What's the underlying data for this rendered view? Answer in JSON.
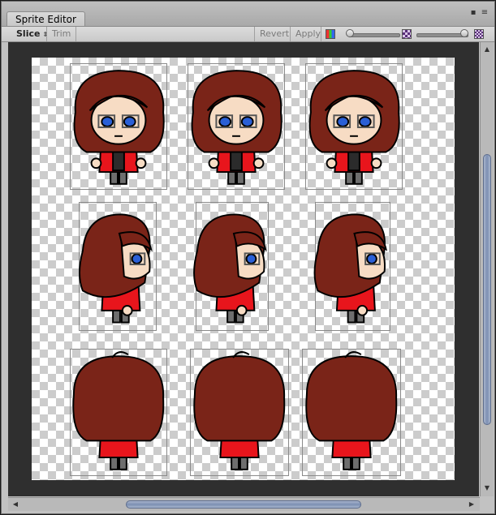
{
  "window": {
    "title": "Sprite Editor",
    "menu_icon": "window-menu-icon",
    "close_icon": "maximize-icon"
  },
  "toolbar": {
    "slice_label": "Slice",
    "slice_arrow": "⇕",
    "trim_label": "Trim",
    "revert_label": "Revert",
    "apply_label": "Apply",
    "rgb_icon": "color-channel-icon",
    "zoom_icon": "zoom-checker-icon",
    "mip_icon": "mipmap-checker-icon",
    "zoom_level": 0.0,
    "mip_level": 1.0
  },
  "scroll": {
    "vertical_position": 0.35,
    "horizontal_position": 0.5
  },
  "sprite_sheet": {
    "rows": [
      {
        "direction": "front"
      },
      {
        "direction": "side"
      },
      {
        "direction": "back"
      }
    ],
    "colors": {
      "hair": "#7a2418",
      "skin": "#f7dcc4",
      "jacket": "#e8151c",
      "shirt": "#2b2b2b",
      "pants": "#6e6e6e",
      "eyes": "#2a5fd6",
      "outline": "#000000"
    }
  }
}
